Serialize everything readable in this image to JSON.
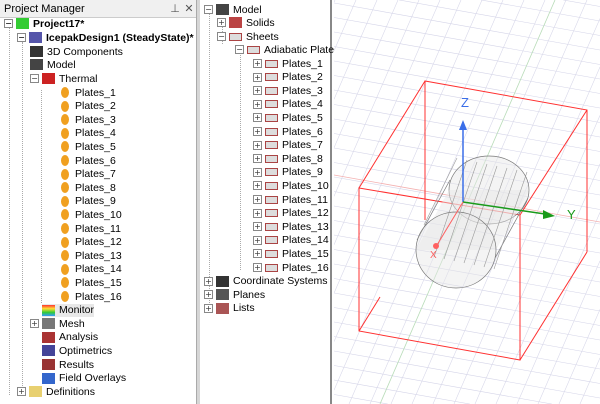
{
  "panel": {
    "title": "Project Manager",
    "pin": "⊥",
    "close": "✕"
  },
  "project_tree": {
    "project": "Project17*",
    "design": "IcepakDesign1 (SteadyState)*",
    "components": "3D Components",
    "model": "Model",
    "thermal": "Thermal",
    "plates": [
      "Plates_1",
      "Plates_2",
      "Plates_3",
      "Plates_4",
      "Plates_5",
      "Plates_6",
      "Plates_7",
      "Plates_8",
      "Plates_9",
      "Plates_10",
      "Plates_11",
      "Plates_12",
      "Plates_13",
      "Plates_14",
      "Plates_15",
      "Plates_16"
    ],
    "monitor": "Monitor",
    "mesh": "Mesh",
    "analysis": "Analysis",
    "optimetrics": "Optimetrics",
    "results": "Results",
    "field_overlays": "Field Overlays",
    "definitions": "Definitions"
  },
  "model_tree": {
    "model": "Model",
    "solids": "Solids",
    "sheets": "Sheets",
    "adiabatic": "Adiabatic Plate",
    "plates": [
      "Plates_1",
      "Plates_2",
      "Plates_3",
      "Plates_4",
      "Plates_5",
      "Plates_6",
      "Plates_7",
      "Plates_8",
      "Plates_9",
      "Plates_10",
      "Plates_11",
      "Plates_12",
      "Plates_13",
      "Plates_14",
      "Plates_15",
      "Plates_16"
    ],
    "coord": "Coordinate Systems",
    "planes": "Planes",
    "lists": "Lists"
  },
  "viewport": {
    "axis_z": "Z",
    "axis_y": "Y",
    "axis_x": "X",
    "colors": {
      "box": "#ff3030",
      "z": "#3a6ee8",
      "y": "#1a9a1a",
      "x": "#ff5050"
    }
  }
}
